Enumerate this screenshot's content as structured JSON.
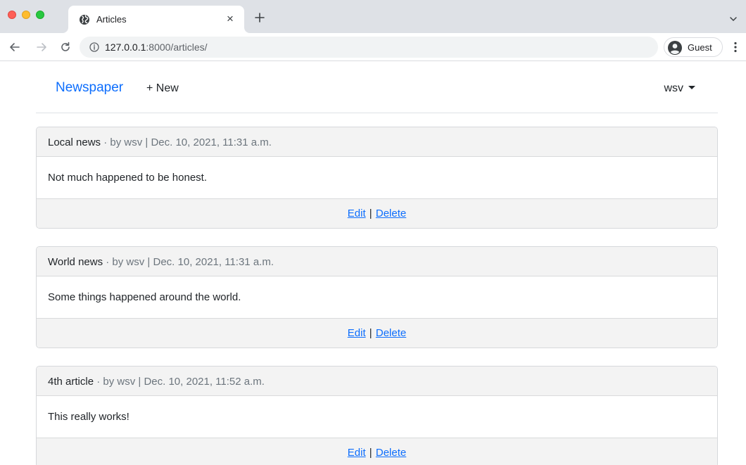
{
  "browser": {
    "tab_title": "Articles",
    "tab_close": "×",
    "url_host": "127.0.0.1",
    "url_rest": ":8000/articles/",
    "profile_label": "Guest"
  },
  "navbar": {
    "brand": "Newspaper",
    "new_link": "+ New",
    "user": "wsv"
  },
  "articles": [
    {
      "title": "Local news",
      "meta": " · by wsv | Dec. 10, 2021, 11:31 a.m.",
      "body": "Not much happened to be honest.",
      "edit_label": "Edit",
      "separator": "|",
      "delete_label": "Delete"
    },
    {
      "title": "World news",
      "meta": " · by wsv | Dec. 10, 2021, 11:31 a.m.",
      "body": "Some things happened around the world.",
      "edit_label": "Edit",
      "separator": "|",
      "delete_label": "Delete"
    },
    {
      "title": "4th article",
      "meta": " · by wsv | Dec. 10, 2021, 11:52 a.m.",
      "body": "This really works!",
      "edit_label": "Edit",
      "separator": "|",
      "delete_label": "Delete"
    }
  ],
  "colors": {
    "link": "#0d6efd",
    "card_header_bg": "#f3f3f3",
    "muted": "#6c757d",
    "chrome_tabstrip": "#dee1e6"
  },
  "icons": {
    "tab_favicon": "globe-icon",
    "new_tab": "plus-icon",
    "back": "arrow-left-icon",
    "forward": "arrow-right-icon",
    "reload": "reload-icon",
    "site_info": "info-icon",
    "profile": "avatar-icon",
    "menu": "kebab-menu-icon",
    "user_menu": "caret-down-icon"
  }
}
